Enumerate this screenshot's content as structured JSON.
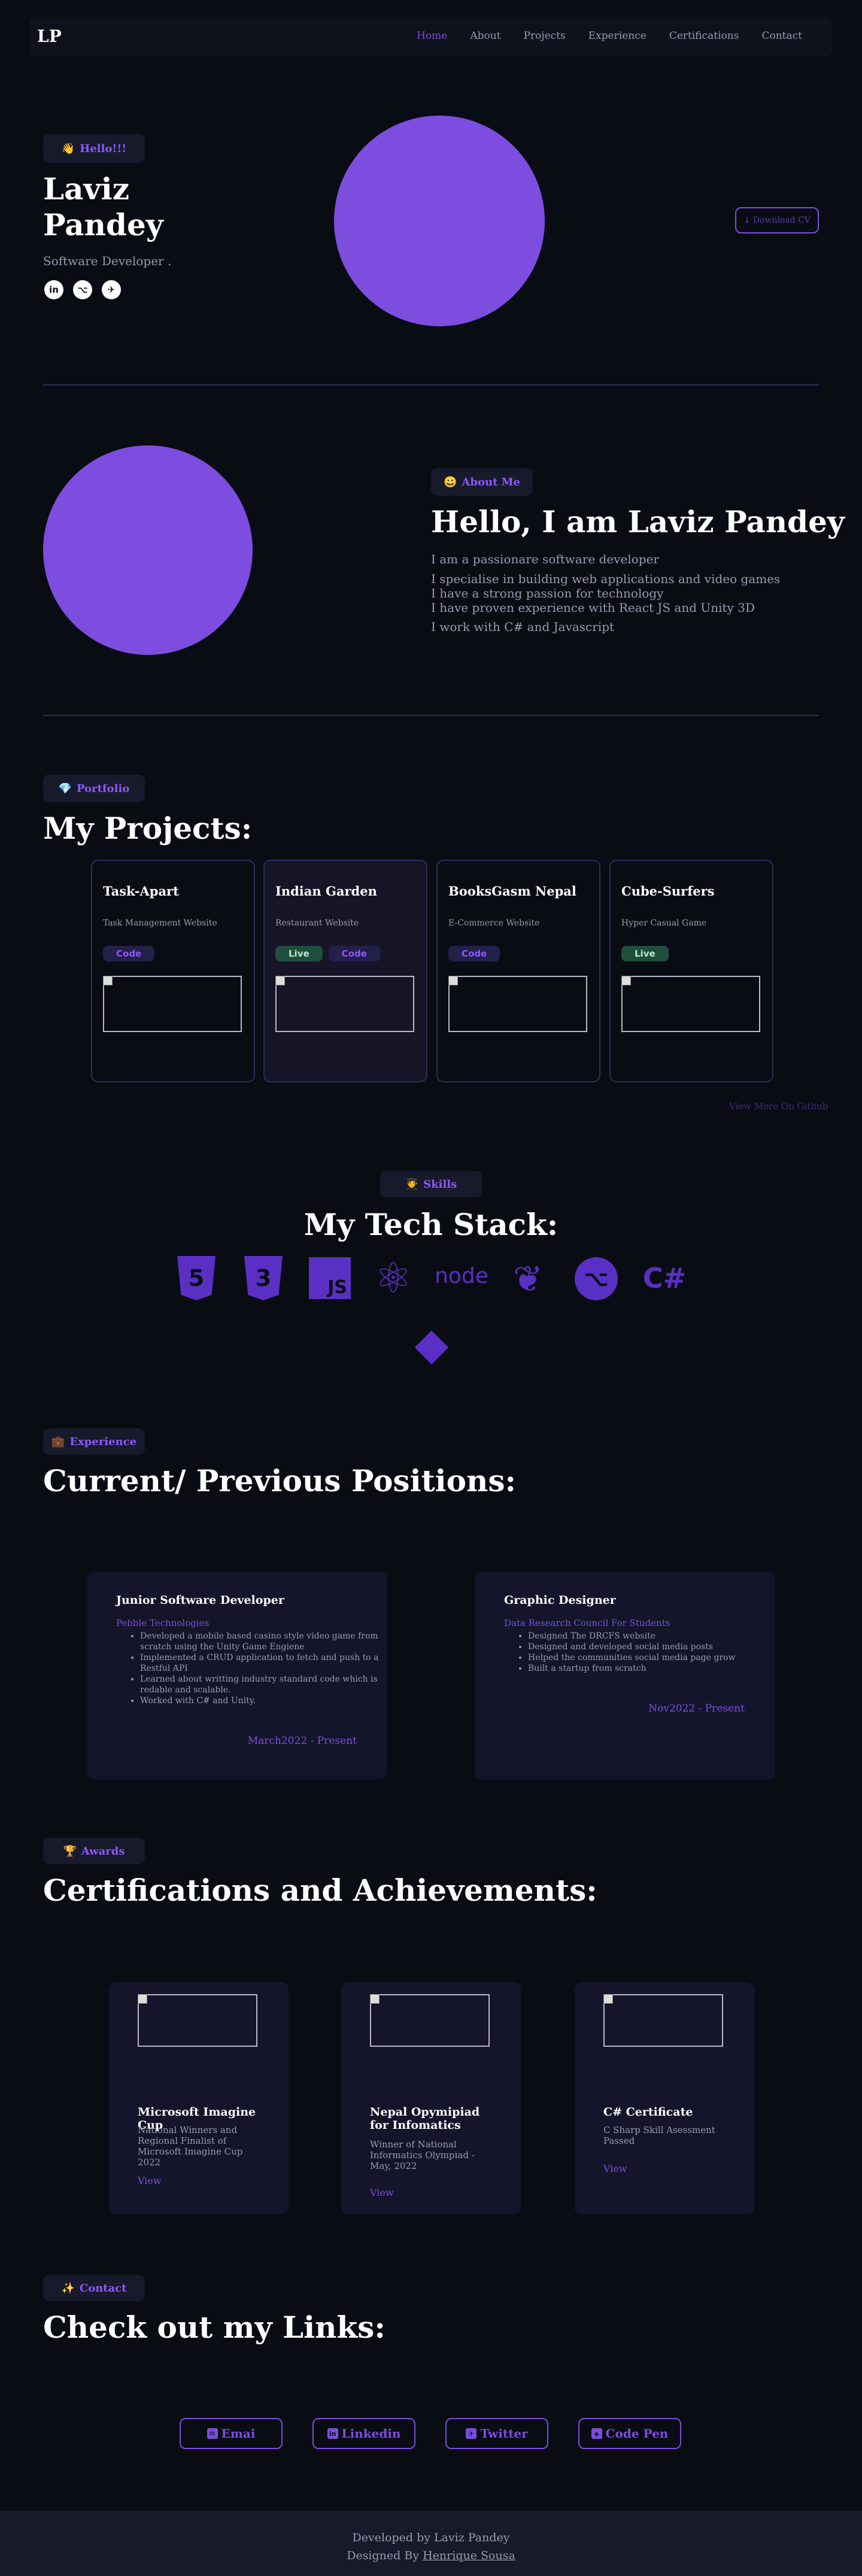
{
  "nav": {
    "logo": "LP",
    "links": [
      "Home",
      "About",
      "Projects",
      "Experience",
      "Certifications",
      "Contact"
    ],
    "active": "Home"
  },
  "hero": {
    "badge_emoji": "👋",
    "badge": "Hello!!!",
    "name_line1": "Laviz",
    "name_line2": "Pandey",
    "role": "Software Developer .",
    "socials": [
      {
        "icon": "linkedin-icon",
        "glyph": "in"
      },
      {
        "icon": "github-icon",
        "glyph": "⌥"
      },
      {
        "icon": "twitter-icon",
        "glyph": "✈"
      }
    ],
    "cv_icon": "⤓",
    "cv_label": "Download CV"
  },
  "about": {
    "badge_emoji": "😀",
    "badge": "About Me",
    "title": "Hello, I am Laviz Pandey",
    "p1": "I am a passionare software developer",
    "p2_l1": "I specialise in building web applications and video games",
    "p2_l2": "I have a strong passion for technology",
    "p2_l3": "I have proven experience with React JS and Unity 3D",
    "p3": "I work with C# and Javascript"
  },
  "portfolio": {
    "badge_emoji": "💎",
    "badge": "Portfolio",
    "title": "My Projects:",
    "projects": [
      {
        "title": "Task-Apart",
        "subtitle": "Task Management Website",
        "buttons": [
          "Code"
        ]
      },
      {
        "title": "Indian Garden",
        "subtitle": "Restaurant Website",
        "buttons": [
          "Live",
          "Code"
        ]
      },
      {
        "title": "BooksGasm Nepal",
        "subtitle": "E-Commerce Website",
        "buttons": [
          "Code"
        ]
      },
      {
        "title": "Cube-Surfers",
        "subtitle": "Hyper Casual Game",
        "buttons": [
          "Live"
        ]
      }
    ],
    "more": "View More On Github"
  },
  "skills": {
    "badge_emoji": "🧑‍🎓",
    "badge": "Skills",
    "title": "My Tech Stack:",
    "tech": [
      {
        "icon": "html5-icon",
        "glyph": "5"
      },
      {
        "icon": "css3-icon",
        "glyph": "3"
      },
      {
        "icon": "javascript-icon",
        "glyph": "JS"
      },
      {
        "icon": "react-icon",
        "glyph": "⚛"
      },
      {
        "icon": "nodejs-icon",
        "glyph": "node"
      },
      {
        "icon": "mongodb-icon",
        "glyph": "❦"
      },
      {
        "icon": "github-icon",
        "glyph": "⌥"
      },
      {
        "icon": "csharp-icon",
        "glyph": "C#"
      },
      {
        "icon": "unity-icon",
        "glyph": "◆"
      }
    ]
  },
  "experience": {
    "badge_emoji": "💼",
    "badge": "Experience",
    "title": "Current/ Previous Positions:",
    "jobs": [
      {
        "title": "Junior Software Developer",
        "company": "Pebble Technologies",
        "bullets": [
          "Developed a mobile based casino style video game from scratch using the Unity Game Engiene",
          "Implemented a CRUD application to fetch and push to a Restful API",
          "Learned about writting industry standard code which is redable and scalable.",
          "Worked with C# and Unity."
        ],
        "date": "March2022 - Present"
      },
      {
        "title": "Graphic Designer",
        "company": "Data Research Council For Students",
        "bullets": [
          "Designed The DRCFS website",
          "Designed and developed social media posts",
          "Helped the communities social media page grow",
          "Built a startup from scratch"
        ],
        "date": "Nov2022 - Present"
      }
    ]
  },
  "certs": {
    "badge_emoji": "🏆",
    "badge": "Awards",
    "title": "Certifications and Achievements:",
    "items": [
      {
        "title": "Microsoft Imagine Cup",
        "desc": "National Winners and Regional Finalist of Microsoft Imagine Cup 2022",
        "view": "View"
      },
      {
        "title": "Nepal Opymipiad for Infomatics",
        "desc": "Winner of National Informatics Olympiad - May, 2022",
        "view": "View"
      },
      {
        "title": "C# Certificate",
        "desc": "C Sharp Skill Asessment Passed",
        "view": "View"
      }
    ]
  },
  "contact": {
    "badge_emoji": "✨",
    "badge": "Contact",
    "title": "Check out my Links:",
    "links": [
      {
        "label": "Emai",
        "icon": "email-icon",
        "glyph": "✉"
      },
      {
        "label": "Linkedin",
        "icon": "linkedin-icon",
        "glyph": "in"
      },
      {
        "label": "Twitter",
        "icon": "twitter-icon",
        "glyph": "✈"
      },
      {
        "label": "Code Pen",
        "icon": "codepen-icon",
        "glyph": "◈"
      }
    ]
  },
  "footer": {
    "line1": "Developed by Laviz Pandey",
    "line2_prefix": "Designed By",
    "designer": "Henrique Sousa"
  },
  "colors": {
    "accent": "#7c4ddf",
    "background": "#0a0c14",
    "card": "#14152a",
    "live": "#1e4e3c"
  }
}
